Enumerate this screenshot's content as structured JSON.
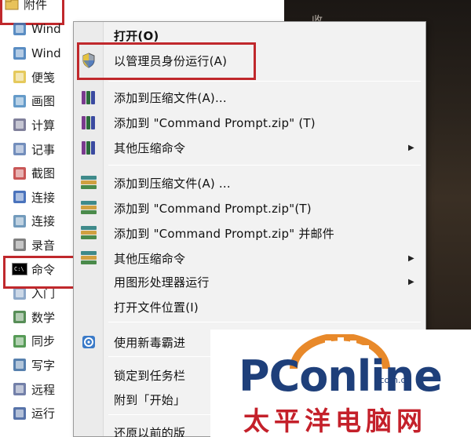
{
  "start_menu": {
    "folder_label": "附件",
    "items": [
      {
        "label": "Wind",
        "icon": "window-app-icon"
      },
      {
        "label": "Wind",
        "icon": "window-app-icon"
      },
      {
        "label": "便笺",
        "icon": "sticky-notes-icon"
      },
      {
        "label": "画图",
        "icon": "paint-icon"
      },
      {
        "label": "计算",
        "icon": "calculator-icon"
      },
      {
        "label": "记事",
        "icon": "notepad-icon"
      },
      {
        "label": "截图",
        "icon": "snipping-tool-icon"
      },
      {
        "label": "连接",
        "icon": "projector-icon"
      },
      {
        "label": "连接",
        "icon": "remote-desktop-icon"
      },
      {
        "label": "录音",
        "icon": "microphone-icon"
      },
      {
        "label": "命令",
        "icon": "command-prompt-icon"
      },
      {
        "label": "入门",
        "icon": "getting-started-icon"
      },
      {
        "label": "数学",
        "icon": "math-panel-icon"
      },
      {
        "label": "同步",
        "icon": "sync-center-icon"
      },
      {
        "label": "写字",
        "icon": "wordpad-icon"
      },
      {
        "label": "远程",
        "icon": "remote-icon"
      },
      {
        "label": "运行",
        "icon": "run-icon"
      }
    ]
  },
  "desktop_partial_text": "收",
  "context_menu": {
    "items": [
      {
        "label": "打开(O)",
        "bold": true
      },
      {
        "label": "以管理员身份运行(A)",
        "icon": "uac-shield-icon"
      },
      {
        "label": "添加到压缩文件(A)...",
        "icon": "winrar-books-icon"
      },
      {
        "label": "添加到 \"Command Prompt.zip\" (T)",
        "icon": "winrar-books-icon"
      },
      {
        "label": "其他压缩命令",
        "icon": "winrar-books-icon",
        "submenu": true
      },
      {
        "label": "添加到压缩文件(A) ...",
        "icon": "archive-stack-icon"
      },
      {
        "label": "添加到 \"Command Prompt.zip\"(T)",
        "icon": "archive-stack-icon"
      },
      {
        "label": "添加到 \"Command Prompt.zip\" 并邮件",
        "icon": "archive-stack-icon"
      },
      {
        "label": "其他压缩命令",
        "icon": "archive-stack-icon",
        "submenu": true
      },
      {
        "label": "用图形处理器运行",
        "submenu": true
      },
      {
        "label": "打开文件位置(I)"
      },
      {
        "label": "使用新毒霸进",
        "icon": "antivirus-icon"
      },
      {
        "label": "锁定到任务栏"
      },
      {
        "label": "附到「开始」"
      },
      {
        "label": "还原以前的版"
      }
    ],
    "submenu_arrow": "▶"
  },
  "watermark": {
    "word": "PConline",
    "domain": ".com.cn",
    "chinese": "太平洋电脑网"
  },
  "colors": {
    "highlight_box": "#c0282c",
    "logo_blue": "#1e3f7a",
    "logo_red": "#c4202a",
    "logo_orange": "#e8892a"
  }
}
